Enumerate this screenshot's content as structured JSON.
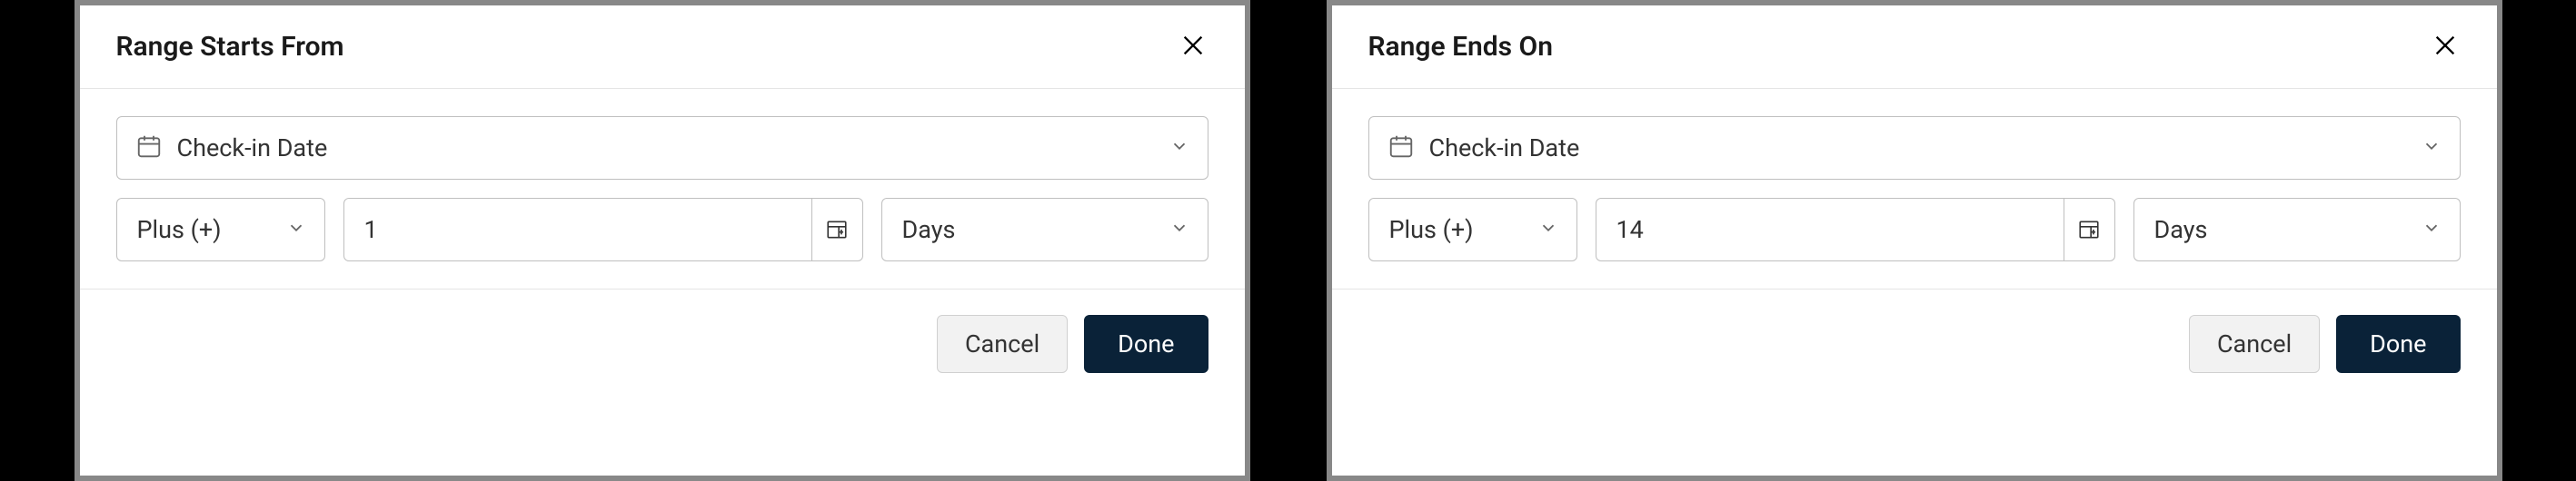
{
  "modals": [
    {
      "title": "Range Starts From",
      "dateRef": "Check-in Date",
      "operator": "Plus (+)",
      "value": "1",
      "unit": "Days",
      "cancel": "Cancel",
      "done": "Done"
    },
    {
      "title": "Range Ends On",
      "dateRef": "Check-in Date",
      "operator": "Plus (+)",
      "value": "14",
      "unit": "Days",
      "cancel": "Cancel",
      "done": "Done"
    }
  ]
}
